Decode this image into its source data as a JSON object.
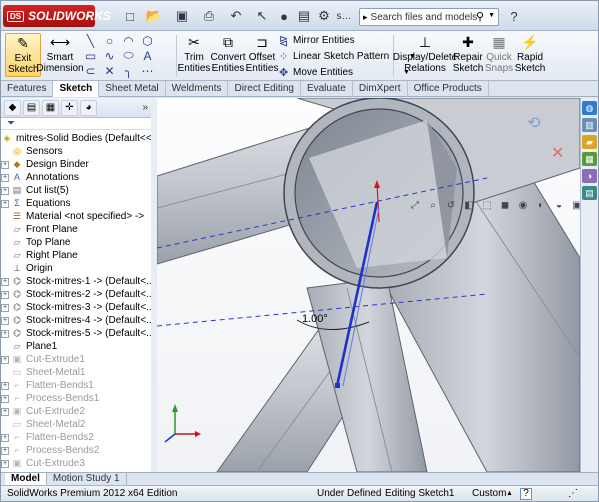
{
  "app": {
    "brand": "SOLIDWORKS",
    "brand_prefix": "DS"
  },
  "search": {
    "placeholder": "Search files and models"
  },
  "commands": {
    "exit_sketch": "Exit Sketch",
    "smart_dimension": "Smart Dimension",
    "trim_entities": "Trim Entities",
    "convert_entities": "Convert Entities",
    "offset_entities": "Offset Entities",
    "mirror_entities": "Mirror Entities",
    "linear_sketch_pattern": "Linear Sketch Pattern",
    "move_entities": "Move Entities",
    "display_delete_relations": "Display/Delete Relations",
    "repair_sketch": "Repair Sketch",
    "quick_snaps": "Quick Snaps",
    "rapid_sketch": "Rapid Sketch"
  },
  "tabs": [
    "Features",
    "Sketch",
    "Sheet Metal",
    "Weldments",
    "Direct Editing",
    "Evaluate",
    "DimXpert",
    "Office Products"
  ],
  "active_tab": "Sketch",
  "tree": {
    "root": "mitres-Solid Bodies  (Default<<D",
    "items": [
      {
        "label": "Sensors",
        "icon": "sensor-icon",
        "expand": false,
        "grey": false
      },
      {
        "label": "Design Binder",
        "icon": "binder-icon",
        "expand": true,
        "grey": false
      },
      {
        "label": "Annotations",
        "icon": "annotation-icon",
        "expand": true,
        "grey": false
      },
      {
        "label": "Cut list(5)",
        "icon": "cutlist-icon",
        "expand": true,
        "grey": false
      },
      {
        "label": "Equations",
        "icon": "equation-icon",
        "expand": true,
        "grey": false
      },
      {
        "label": "Material <not specified> ->",
        "icon": "material-icon",
        "expand": false,
        "grey": false
      },
      {
        "label": "Front Plane",
        "icon": "plane-icon",
        "expand": false,
        "grey": false
      },
      {
        "label": "Top Plane",
        "icon": "plane-icon",
        "expand": false,
        "grey": false
      },
      {
        "label": "Right Plane",
        "icon": "plane-icon",
        "expand": false,
        "grey": false
      },
      {
        "label": "Origin",
        "icon": "origin-icon",
        "expand": false,
        "grey": false
      },
      {
        "label": "Stock-mitres-1 -> (Default<...",
        "icon": "structural-member-icon",
        "expand": true,
        "grey": false
      },
      {
        "label": "Stock-mitres-2 -> (Default<...",
        "icon": "structural-member-icon",
        "expand": true,
        "grey": false
      },
      {
        "label": "Stock-mitres-3 -> (Default<...",
        "icon": "structural-member-icon",
        "expand": true,
        "grey": false
      },
      {
        "label": "Stock-mitres-4 -> (Default<...",
        "icon": "structural-member-icon",
        "expand": true,
        "grey": false
      },
      {
        "label": "Stock-mitres-5 -> (Default<...",
        "icon": "structural-member-icon",
        "expand": true,
        "grey": false
      },
      {
        "label": "Plane1",
        "icon": "plane-icon",
        "expand": false,
        "grey": false
      },
      {
        "label": "Cut-Extrude1",
        "icon": "extrude-icon",
        "expand": true,
        "grey": true
      },
      {
        "label": "Sheet-Metal1",
        "icon": "sheetmetal-icon",
        "expand": false,
        "grey": true
      },
      {
        "label": "Flatten-Bends1",
        "icon": "bend-icon",
        "expand": true,
        "grey": true
      },
      {
        "label": "Process-Bends1",
        "icon": "bend-icon",
        "expand": true,
        "grey": true
      },
      {
        "label": "Cut-Extrude2",
        "icon": "extrude-icon",
        "expand": true,
        "grey": true
      },
      {
        "label": "Sheet-Metal2",
        "icon": "sheetmetal-icon",
        "expand": false,
        "grey": true
      },
      {
        "label": "Flatten-Bends2",
        "icon": "bend-icon",
        "expand": true,
        "grey": true
      },
      {
        "label": "Process-Bends2",
        "icon": "bend-icon",
        "expand": true,
        "grey": true
      },
      {
        "label": "Cut-Extrude3",
        "icon": "extrude-icon",
        "expand": true,
        "grey": true
      }
    ]
  },
  "viewport": {
    "dimension_value": "1.00°"
  },
  "bottom_tabs": [
    "Model",
    "Motion Study 1"
  ],
  "status": {
    "edition": "SolidWorks Premium 2012 x64 Edition",
    "sketch_state": "Under Defined",
    "editing": "Editing Sketch1",
    "units": "Custom",
    "help": "?"
  },
  "colors": {
    "brand_red": "#c41a1a",
    "sketch_blue": "#1f32c8",
    "tube_grey": "#b9bdc5"
  }
}
